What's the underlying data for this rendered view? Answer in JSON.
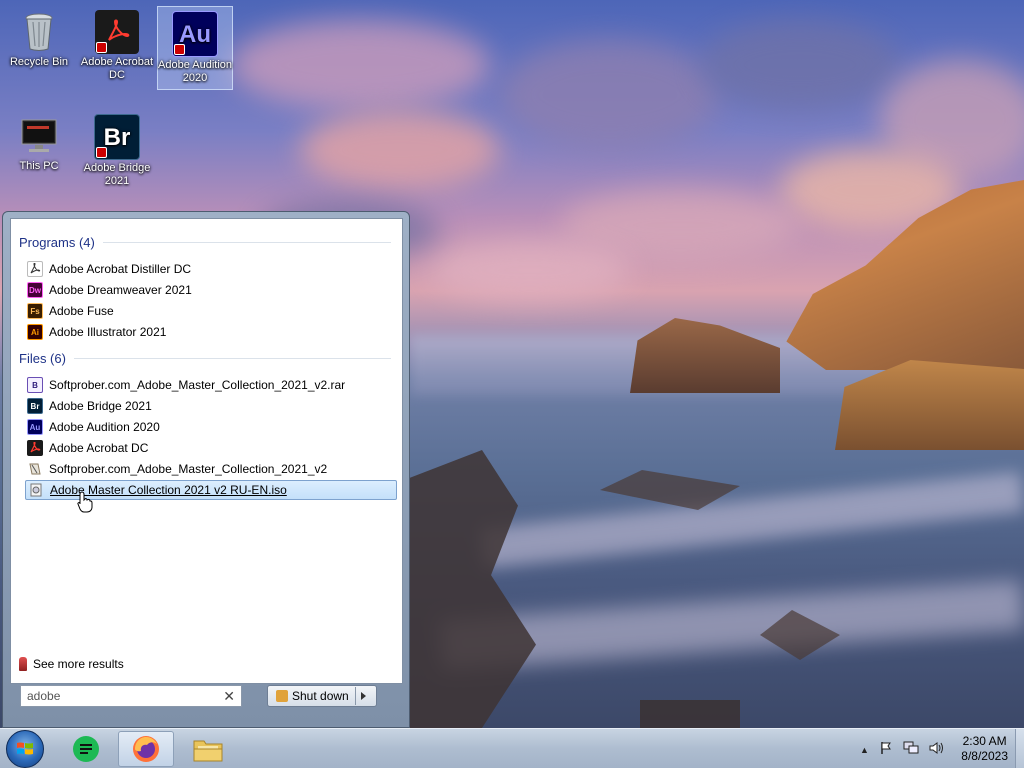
{
  "desktop": {
    "icons": [
      {
        "label": "Recycle Bin"
      },
      {
        "label": "Adobe Acrobat DC",
        "glyph": "pdf-icon"
      },
      {
        "label": "Adobe Audition 2020",
        "glyph_text": "Au"
      },
      {
        "label": "This PC"
      },
      {
        "label": "Adobe Bridge 2021",
        "glyph_text": "Br"
      }
    ]
  },
  "start_menu": {
    "programs_header": "Programs (4)",
    "programs": [
      {
        "label": "Adobe Acrobat Distiller DC",
        "icon": "acrobat-icon"
      },
      {
        "label": "Adobe Dreamweaver 2021",
        "icon": "Dw"
      },
      {
        "label": "Adobe Fuse",
        "icon": "Fs"
      },
      {
        "label": "Adobe Illustrator 2021",
        "icon": "Ai"
      }
    ],
    "files_header": "Files (6)",
    "files": [
      {
        "label": "Softprober.com_Adobe_Master_Collection_2021_v2.rar",
        "icon": "rar-archive-icon"
      },
      {
        "label": "Adobe Bridge 2021",
        "icon": "Br"
      },
      {
        "label": "Adobe Audition 2020",
        "icon": "Au"
      },
      {
        "label": "Adobe Acrobat DC",
        "icon": "acrobat-icon"
      },
      {
        "label": "Softprober.com_Adobe_Master_Collection_2021_v2",
        "icon": "folder-shortcut-icon"
      },
      {
        "label": "Adobe Master Collection 2021 v2 RU-EN.iso",
        "icon": "disc-image-icon"
      }
    ],
    "see_more": "See more results",
    "search_value": "adobe",
    "shutdown_label": "Shut down"
  },
  "taskbar": {
    "time": "2:30 AM",
    "date": "8/8/2023"
  },
  "colors": {
    "highlight": "#c4e0fa",
    "section_header": "#1e3287",
    "au_bg": "#00005b",
    "au_fg": "#9999ff",
    "br_bg": "#001e36",
    "dw_bg": "#470137",
    "fs_bg": "#3a1e00",
    "ai_bg": "#330000"
  }
}
